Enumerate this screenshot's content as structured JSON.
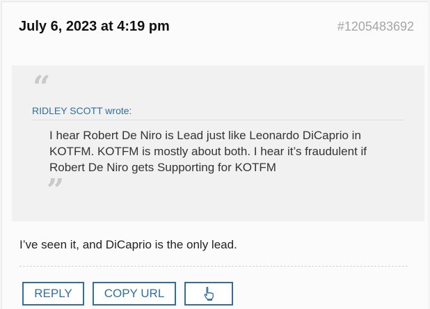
{
  "post": {
    "date": "July 6, 2023 at 4:19 pm",
    "id": "#1205483692",
    "reply_text": "I’ve seen it, and DiCaprio is the only lead."
  },
  "quote": {
    "open_mark": "“",
    "close_mark": "”",
    "author": "RIDLEY SCOTT",
    "wrote_label": "wrote:",
    "text": "I hear Robert De Niro is Lead just like Leonardo DiCaprio in KOTFM. KOTFM is mostly about both. I hear it’s fraudulent if Robert De Niro gets Supporting for KOTFM"
  },
  "actions": {
    "reply_label": "REPLY",
    "copy_url_label": "COPY URL",
    "like_icon": "thumbs-up-icon"
  },
  "colors": {
    "accent": "#2f6e9e",
    "background": "#fbfbfb",
    "quote_background": "#f1f1f1",
    "muted": "#a6a6a6"
  }
}
